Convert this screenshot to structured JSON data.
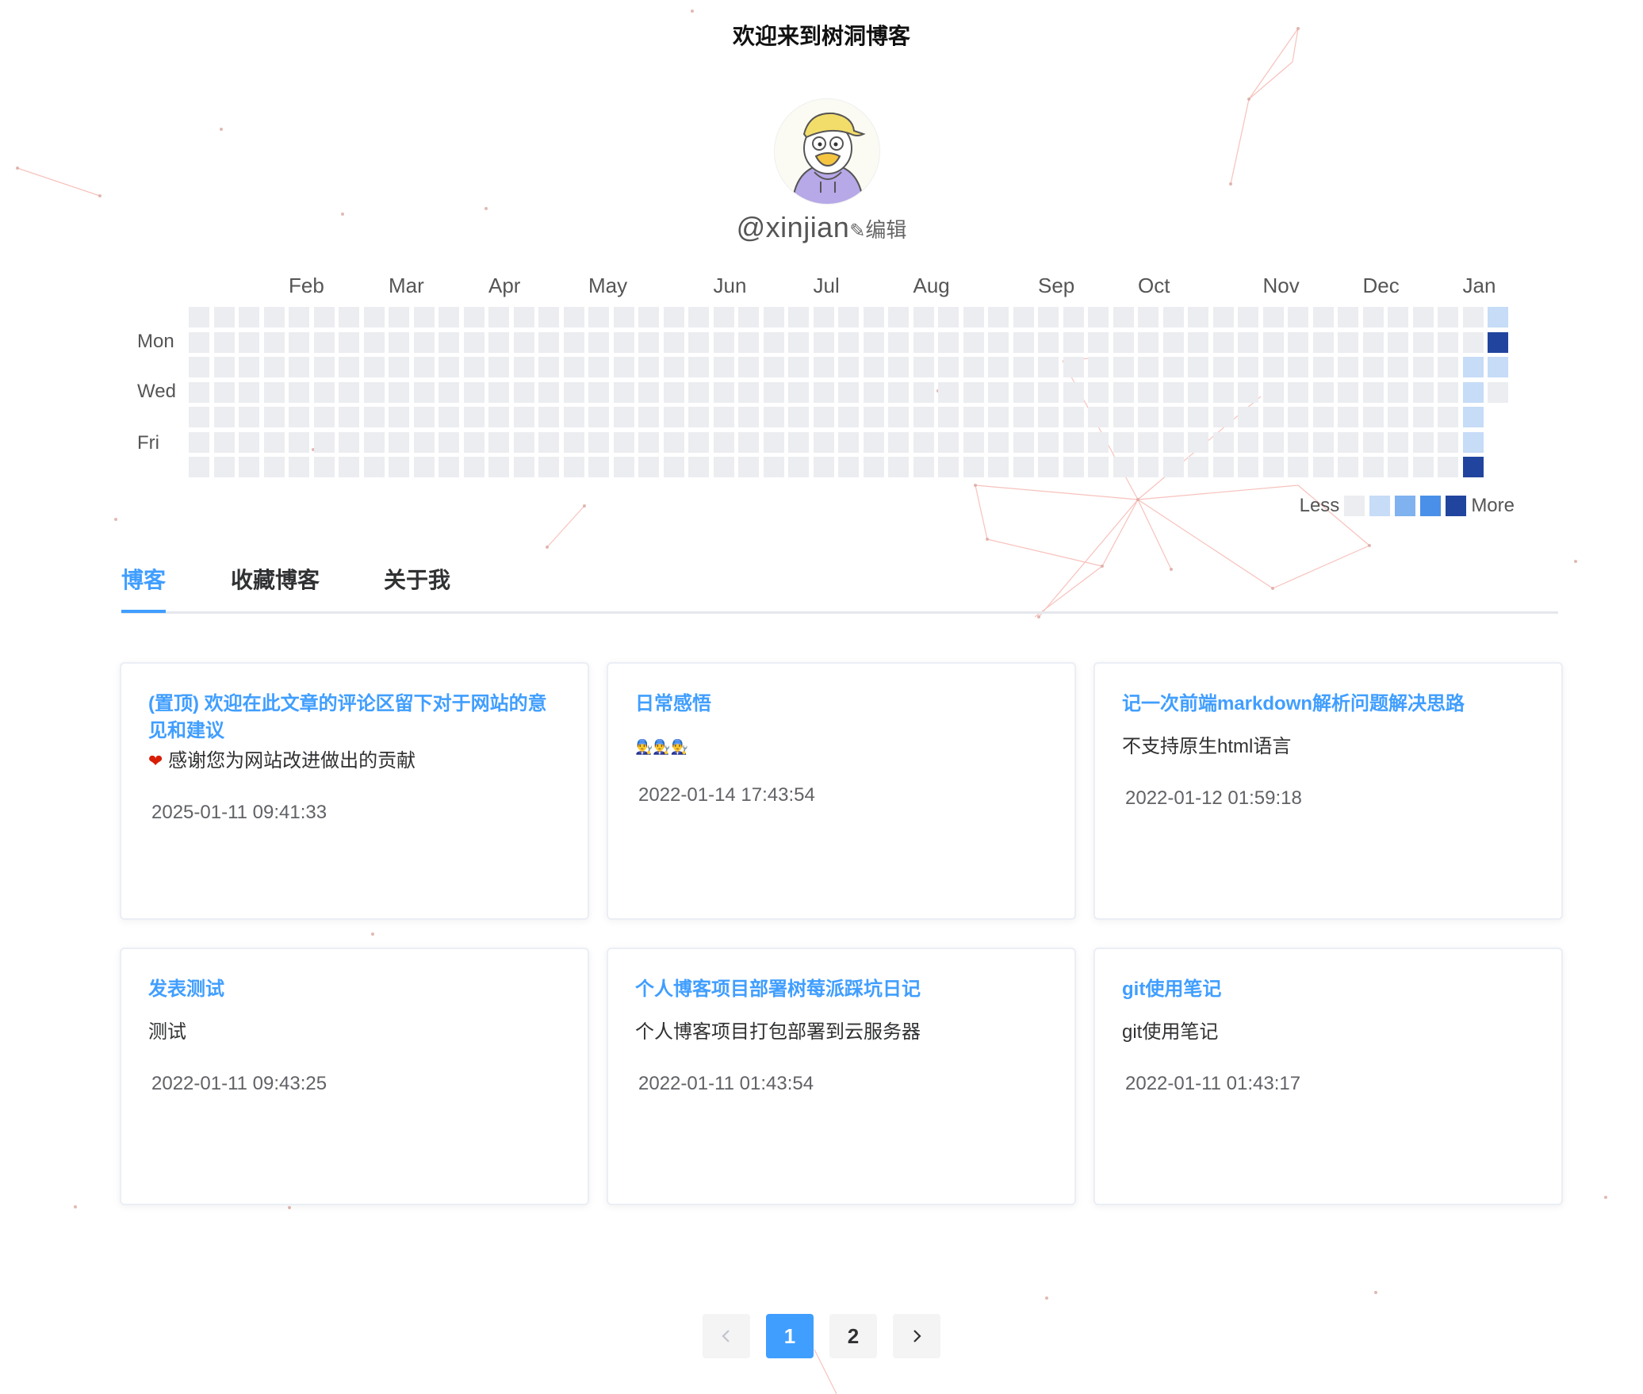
{
  "header": {
    "title": "欢迎来到树洞博客"
  },
  "profile": {
    "handle": "@xinjian",
    "edit_label": "编辑",
    "edit_icon": "pencil-icon",
    "avatar_icon": "duck-avatar"
  },
  "heatmap": {
    "months": [
      "Feb",
      "Mar",
      "Apr",
      "May",
      "Jun",
      "Jul",
      "Aug",
      "Sep",
      "Oct",
      "Nov",
      "Dec",
      "Jan"
    ],
    "day_labels": [
      "Mon",
      "Wed",
      "Fri"
    ],
    "legend_less": "Less",
    "legend_more": "More",
    "legend_colors": [
      "#ebedf0",
      "#c6dcf7",
      "#7fb2ee",
      "#4a90e8",
      "#21459e"
    ]
  },
  "tabs": [
    {
      "label": "博客",
      "active": true
    },
    {
      "label": "收藏博客",
      "active": false
    },
    {
      "label": "关于我",
      "active": false
    }
  ],
  "posts": [
    {
      "title": "(置顶) 欢迎在此文章的评论区留下对于网站的意见和建议",
      "summary": "感谢您为网站改进做出的贡献",
      "date": "2025-01-11 09:41:33"
    },
    {
      "title": "日常感悟",
      "summary": "👨‍🔧👨‍🔧👨‍🔧",
      "date": "2022-01-14 17:43:54"
    },
    {
      "title": "记一次前端markdown解析问题解决思路",
      "summary": "不支持原生html语言",
      "date": "2022-01-12 01:59:18"
    },
    {
      "title": "发表测试",
      "summary": "测试",
      "date": "2022-01-11 09:43:25"
    },
    {
      "title": "个人博客项目部署树莓派踩坑日记",
      "summary": "个人博客项目打包部署到云服务器",
      "date": "2022-01-11 01:43:54"
    },
    {
      "title": "git使用笔记",
      "summary": "git使用笔记",
      "date": "2022-01-11 01:43:17"
    }
  ],
  "pagination": {
    "prev_icon": "chevron-left-icon",
    "pages": [
      "1",
      "2"
    ],
    "current": "1",
    "next_icon": "chevron-right-icon"
  },
  "colors": {
    "accent": "#409eff",
    "heat_empty": "#ebedf0",
    "heat_light": "#c6dcf7",
    "heat_dark": "#21459e"
  }
}
